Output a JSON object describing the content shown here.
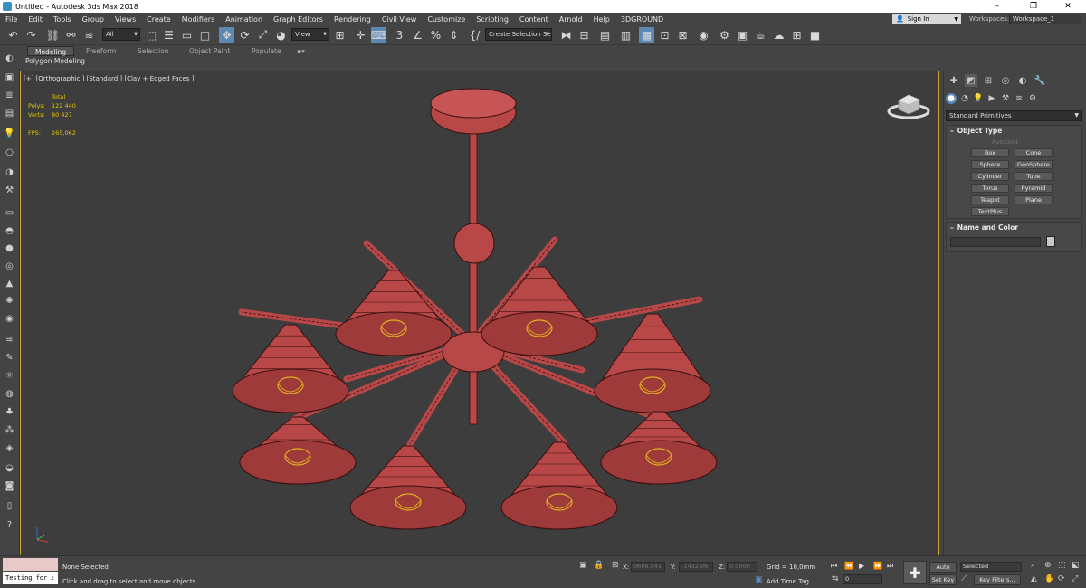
{
  "window": {
    "title": "Untitled - Autodesk 3ds Max 2018",
    "minimize": "–",
    "maximize": "❐",
    "close": "✕"
  },
  "menu": [
    "File",
    "Edit",
    "Tools",
    "Group",
    "Views",
    "Create",
    "Modifiers",
    "Animation",
    "Graph Editors",
    "Rendering",
    "Civil View",
    "Customize",
    "Scripting",
    "Content",
    "Arnold",
    "Help",
    "3DGROUND"
  ],
  "account": {
    "signin": "Sign In",
    "workspaces_label": "Workspaces:",
    "workspace": "Workspace_1"
  },
  "toolbar": {
    "filter": "All",
    "ref_coord": "View",
    "selection_set": "Create Selection Se"
  },
  "ribbon": {
    "tabs": [
      "Modeling",
      "Freeform",
      "Selection",
      "Object Paint",
      "Populate"
    ],
    "subtitle": "Polygon Modeling"
  },
  "viewport": {
    "label": "[+] [Orthographic ] [Standard ] [Clay + Edged Faces ]",
    "stats": {
      "total_label": "Total",
      "polys_label": "Polys:",
      "polys": "122 440",
      "verts_label": "Verts:",
      "verts": "80 427",
      "fps_label": "FPS:",
      "fps": "265,062"
    },
    "mesh_color": "#b84848",
    "wire_color": "#3a1010",
    "bulb_color": "#e0b020"
  },
  "command_panel": {
    "category": "Standard Primitives",
    "object_type": {
      "title": "Object Type",
      "autogrid": "AutoGrid",
      "buttons": [
        "Box",
        "Cone",
        "Sphere",
        "GeoSphere",
        "Cylinder",
        "Tube",
        "Torus",
        "Pyramid",
        "Teapot",
        "Plane",
        "TextPlus"
      ]
    },
    "name_color": {
      "title": "Name and Color"
    },
    "expand_sign": "–"
  },
  "status": {
    "maxscript_input": "Testing for :",
    "selection": "None Selected",
    "prompt": "Click and drag to select and move objects",
    "x_label": "X:",
    "x": "0698,941",
    "y_label": "Y:",
    "y": "-1432,06",
    "z_label": "Z:",
    "z": "0,0mm",
    "grid": "Grid = 10,0mm",
    "add_time_tag": "Add Time Tag",
    "auto_key": "Auto Key",
    "selected": "Selected",
    "set_key": "Set Key",
    "key_filters": "Key Filters...",
    "frame": "0"
  }
}
